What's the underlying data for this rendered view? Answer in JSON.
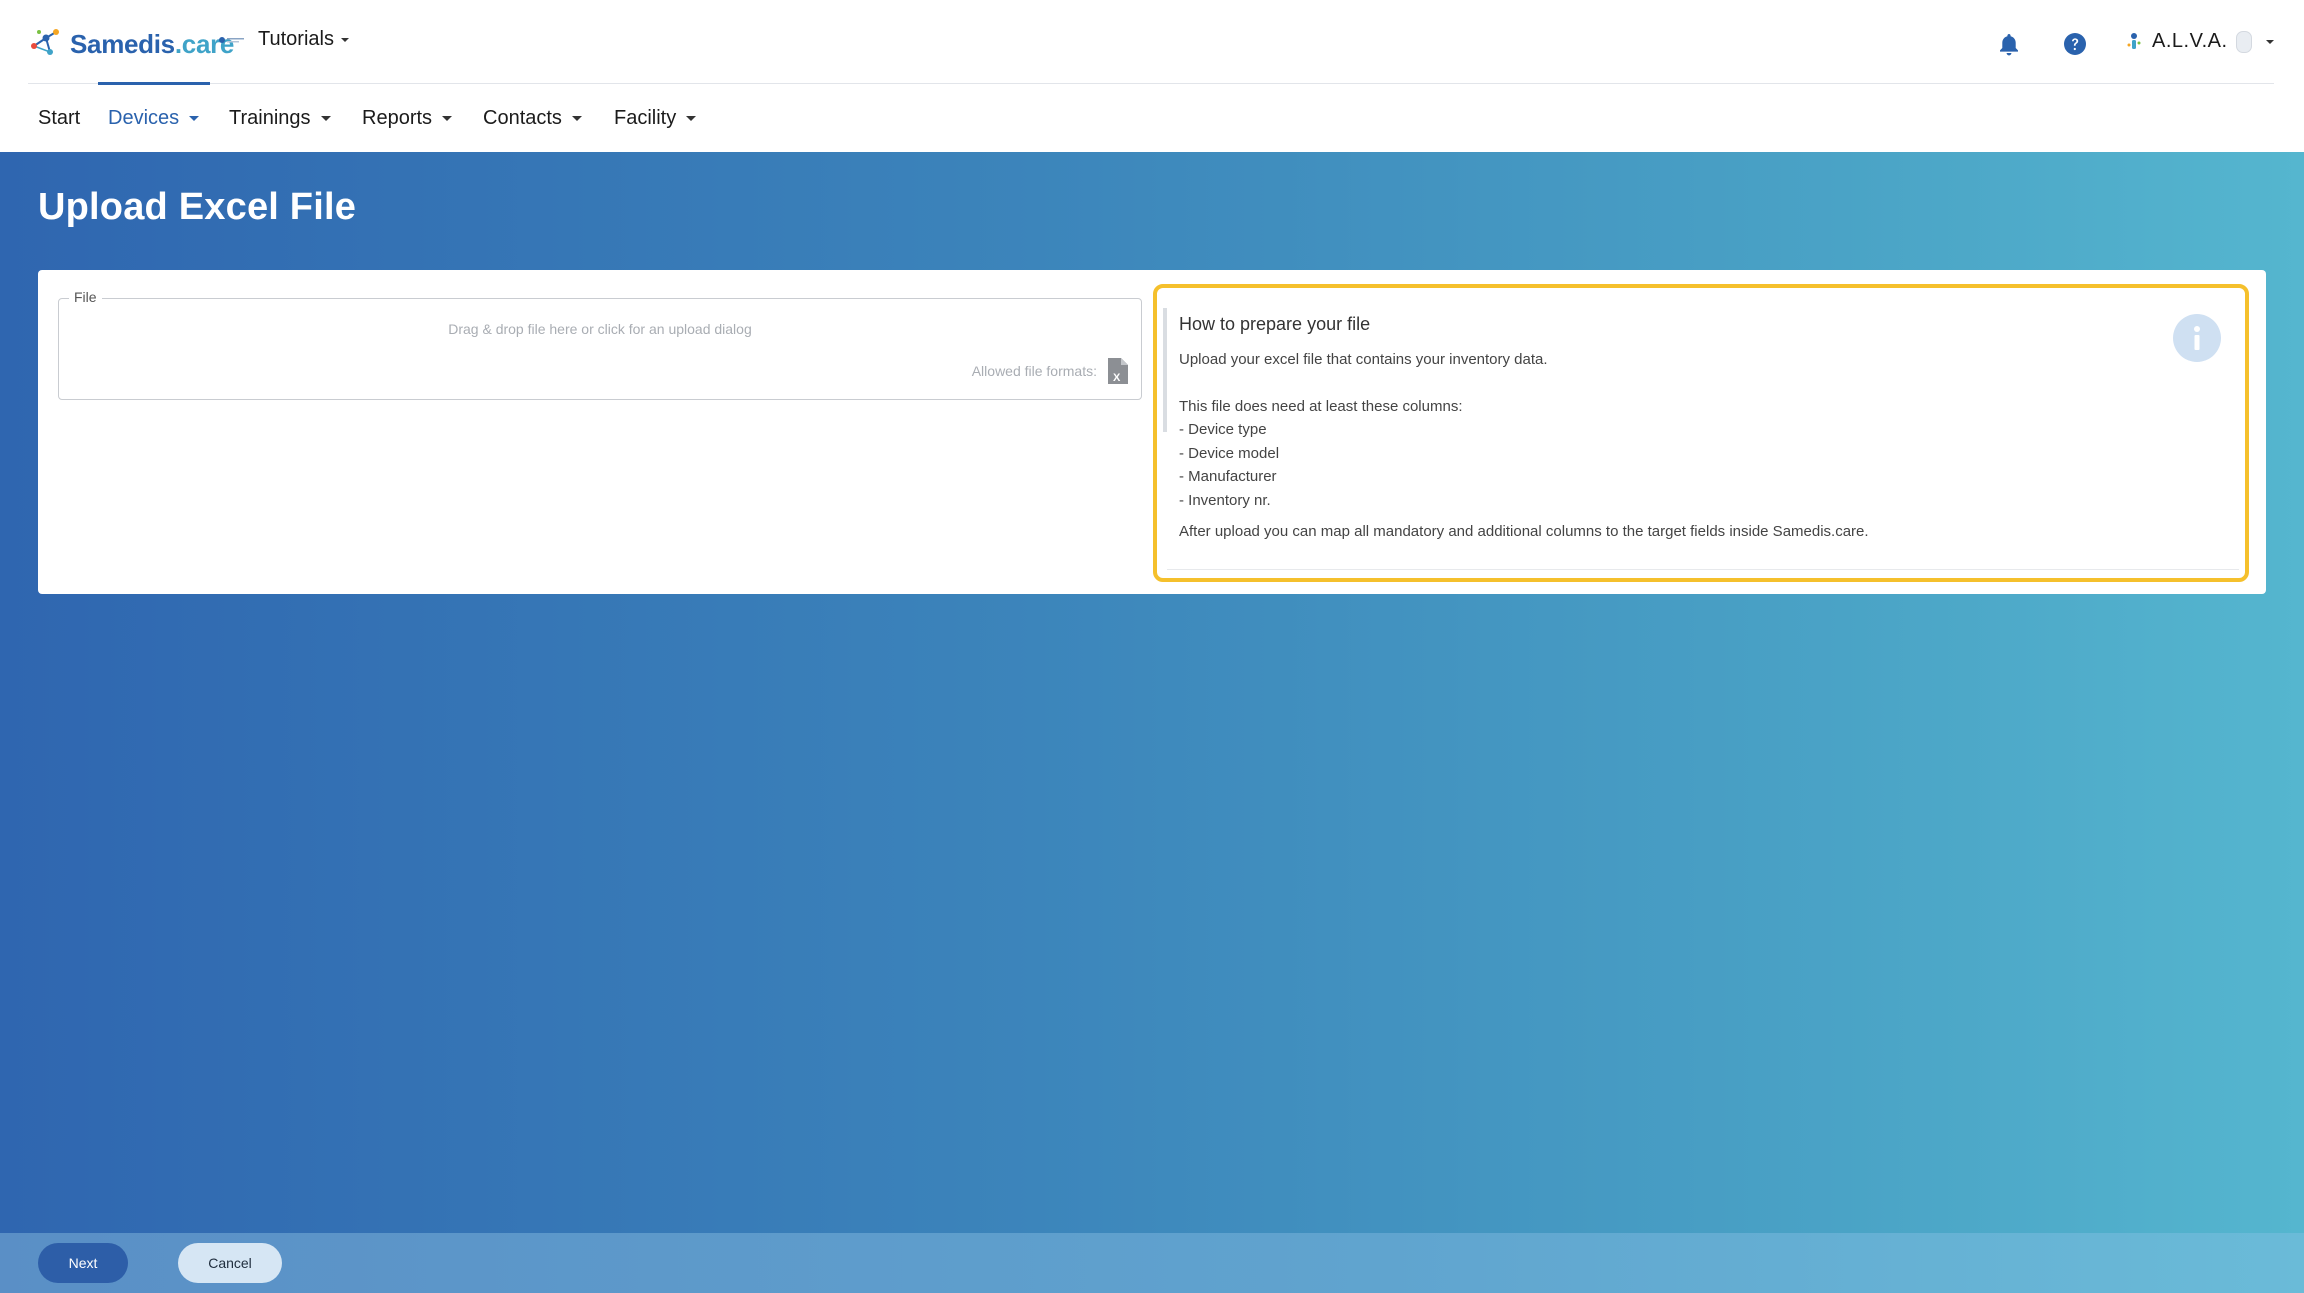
{
  "app": {
    "brand_part1": "Samedis",
    "brand_part2": ".care",
    "tenant_label": "Tutorials",
    "user_label": "A.L.V.A."
  },
  "nav": {
    "items": [
      {
        "label": "Start"
      },
      {
        "label": "Devices"
      },
      {
        "label": "Trainings"
      },
      {
        "label": "Reports"
      },
      {
        "label": "Contacts"
      },
      {
        "label": "Facility"
      }
    ],
    "active": "Devices"
  },
  "page": {
    "title": "Upload Excel File"
  },
  "file_field": {
    "legend": "File",
    "drop_text": "Drag & drop file here or click for an upload dialog",
    "formats_label": "Allowed file formats:"
  },
  "info": {
    "title": "How to prepare your file",
    "line1": "Upload your excel file that contains your inventory data.",
    "line2": "This file does need at least these columns:",
    "columns": [
      "- Device type",
      "- Device model",
      "- Manufacturer",
      "- Inventory nr."
    ],
    "line3": "After upload you can map all mandatory and additional columns to the target fields inside Samedis.care."
  },
  "footer": {
    "next_label": "Next",
    "cancel_label": "Cancel"
  },
  "colors": {
    "brand_blue": "#2a62ad",
    "brand_cyan": "#3fa3c8",
    "highlight": "#f5c02c",
    "next_button": "#2d5ea8",
    "cancel_button": "#d6e6f4"
  },
  "icons": [
    "samedis-logo-icon",
    "tenant-logo-icon",
    "bell-icon",
    "help-icon",
    "user-icon",
    "excel-file-icon",
    "info-icon"
  ]
}
